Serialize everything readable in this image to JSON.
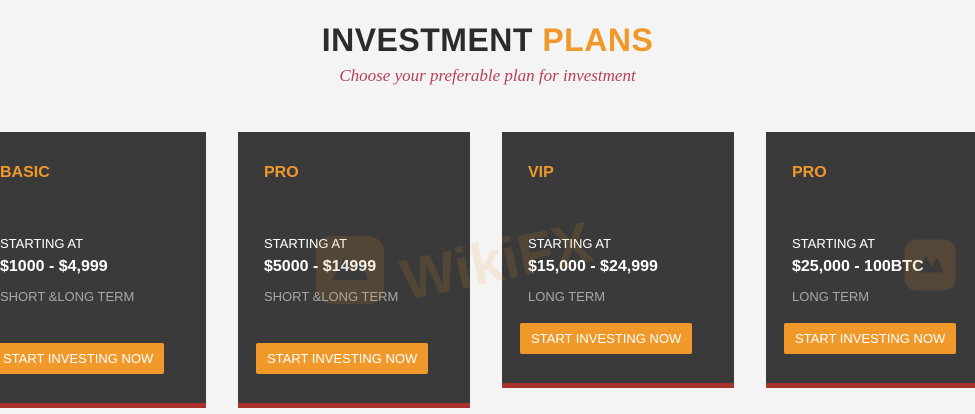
{
  "header": {
    "title_part1": "INVESTMENT",
    "title_part2": "PLANS",
    "subtitle": "Choose your preferable plan for investment"
  },
  "plans": [
    {
      "name": "BASIC",
      "starting_label": "STARTING AT",
      "range": "$1000 - $4,999",
      "term": "SHORT &LONG TERM",
      "button_label": "START INVESTING NOW"
    },
    {
      "name": "PRO",
      "starting_label": "STARTING AT",
      "range": "$5000 - $14999",
      "term": "SHORT &LONG TERM",
      "button_label": "START INVESTING NOW"
    },
    {
      "name": "VIP",
      "starting_label": "STARTING AT",
      "range": "$15,000 - $24,999",
      "term": "LONG TERM",
      "button_label": "START INVESTING NOW"
    },
    {
      "name": "PRO",
      "starting_label": "STARTING AT",
      "range": "$25,000 - 100BTC",
      "term": "LONG TERM",
      "button_label": "START INVESTING NOW"
    }
  ],
  "watermark": {
    "text": "WikiFX"
  },
  "colors": {
    "background": "#f4f4f5",
    "card": "#3a3a3a",
    "accent_orange": "#f0992a",
    "accent_red": "#a8322d",
    "subtitle": "#b8405a"
  }
}
